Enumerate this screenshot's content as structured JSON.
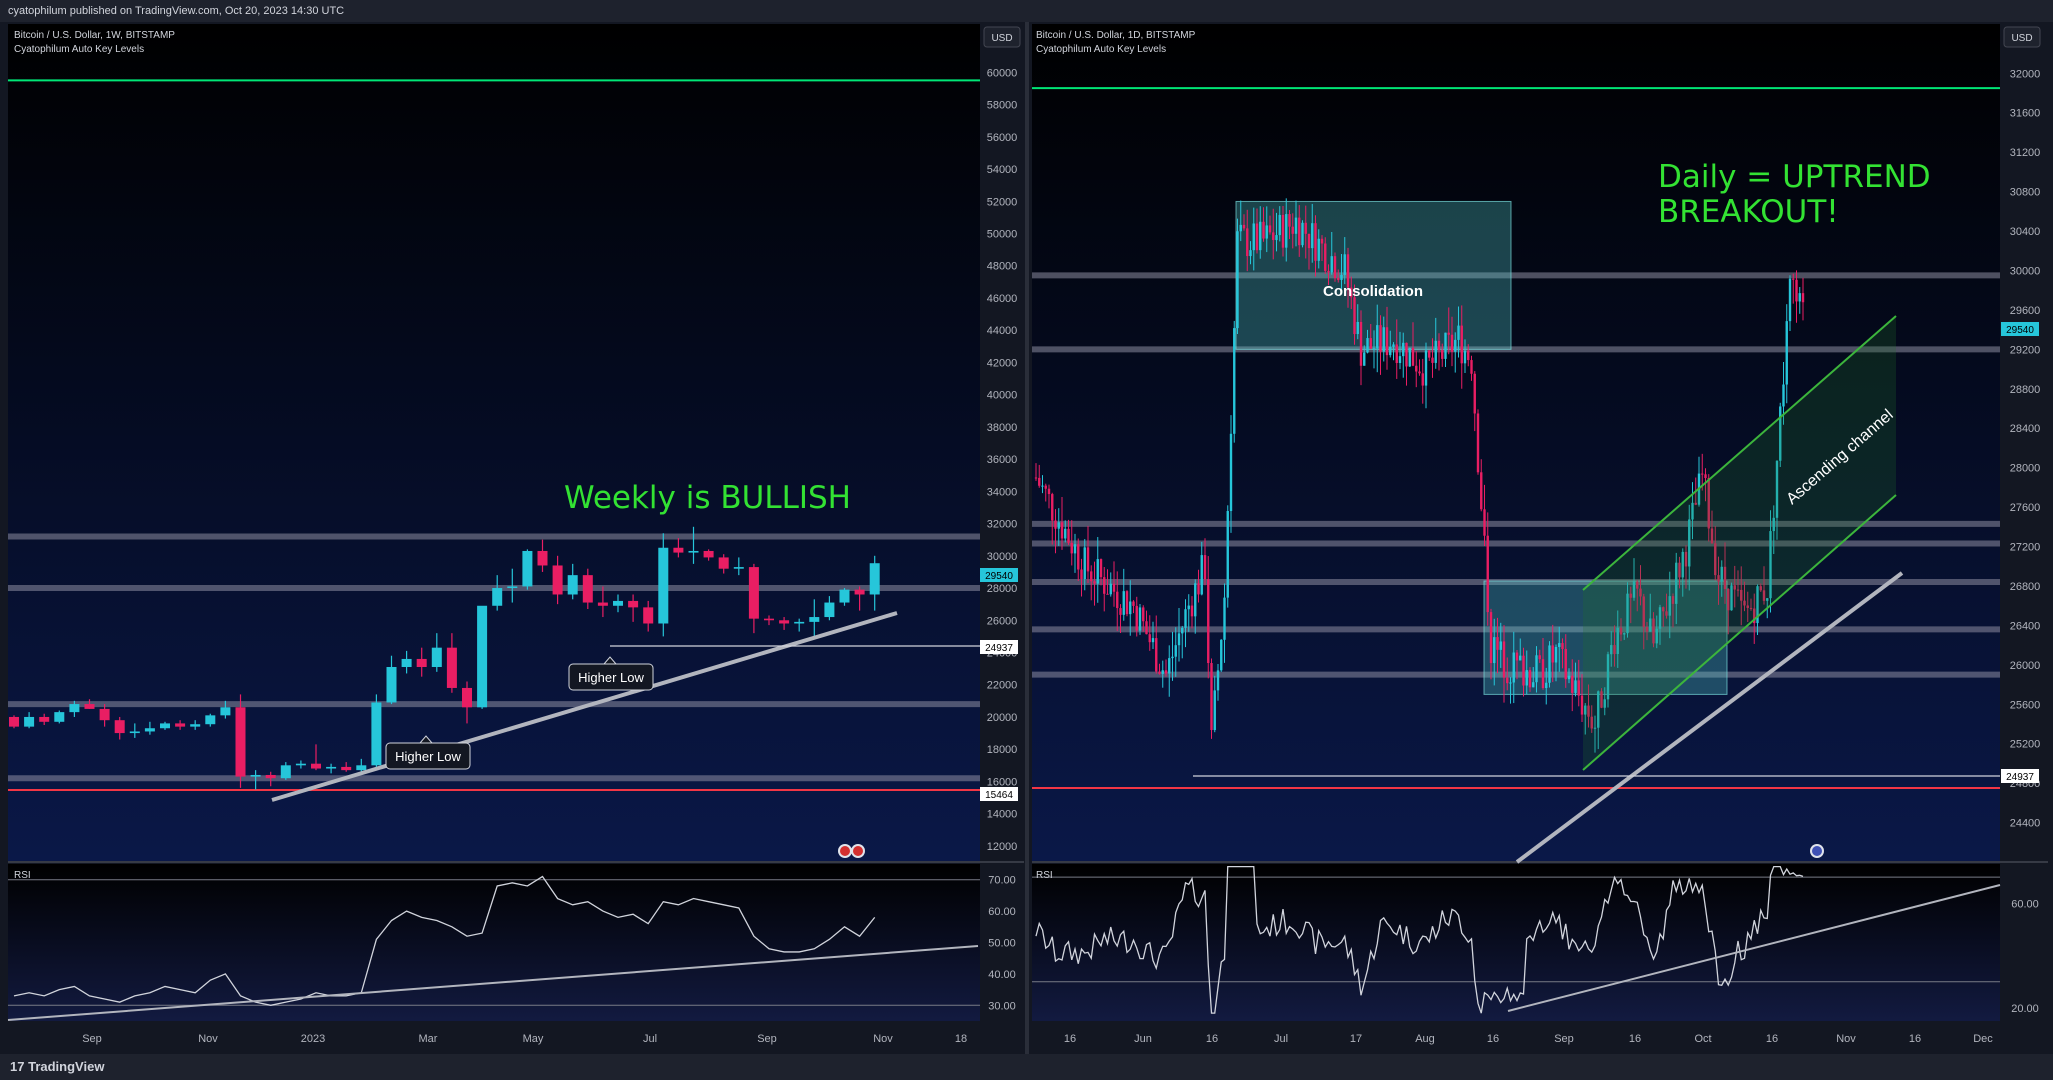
{
  "publish_info": "cyatophilum published on TradingView.com, Oct 20, 2023 14:30 UTC",
  "footer": {
    "brand": "TradingView",
    "logo_mark": "17"
  },
  "panels": {
    "weekly": {
      "symbol_line": "Bitcoin / U.S. Dollar, 1W, BITSTAMP",
      "indicator": "Cyatophilum Auto Key Levels",
      "currency": "USD",
      "rsi_label": "RSI",
      "price_tag": "29540",
      "level_tag_1": "24937",
      "level_tag_2": "15464",
      "annotation": "Weekly is BULLISH",
      "callout_1": "Higher Low",
      "callout_2": "Higher Low"
    },
    "daily": {
      "symbol_line": "Bitcoin / U.S. Dollar, 1D, BITSTAMP",
      "indicator": "Cyatophilum Auto Key Levels",
      "currency": "USD",
      "rsi_label": "RSI",
      "price_tag": "29540",
      "level_tag_1": "24937",
      "annotation_line1": "Daily = UPTREND",
      "annotation_line2": "BREAKOUT!",
      "box_label": "Consolidation",
      "channel_label": "Ascending channel"
    }
  },
  "colors": {
    "up": "#26c6da",
    "down": "#e91e63",
    "green_level": "#00e676",
    "red_level": "#f23645",
    "annotation": "#33e233",
    "background": "#131722"
  },
  "chart_data": [
    {
      "type": "candlestick",
      "title": "Bitcoin / U.S. Dollar, 1W, BITSTAMP",
      "ylim": [
        11000,
        63000
      ],
      "yticks": [
        12000,
        14000,
        16000,
        18000,
        20000,
        22000,
        24000,
        26000,
        28000,
        30000,
        32000,
        34000,
        36000,
        38000,
        40000,
        42000,
        44000,
        46000,
        48000,
        50000,
        52000,
        54000,
        56000,
        58000,
        60000,
        62000
      ],
      "xticks": [
        "Sep",
        "Nov",
        "2023",
        "Mar",
        "May",
        "Jul",
        "Sep",
        "Nov",
        "18"
      ],
      "key_levels": [
        59500,
        31200,
        28000,
        20800,
        16200,
        15464,
        24937
      ],
      "candles_ohlc": [
        [
          20000,
          20100,
          19300,
          19400
        ],
        [
          19400,
          20300,
          19300,
          20000
        ],
        [
          20000,
          20200,
          19500,
          19700
        ],
        [
          19700,
          20400,
          19600,
          20300
        ],
        [
          20300,
          21000,
          20000,
          20800
        ],
        [
          20800,
          21100,
          20500,
          20500
        ],
        [
          20500,
          20800,
          19400,
          19800
        ],
        [
          19800,
          20000,
          18600,
          19000
        ],
        [
          19000,
          19600,
          18700,
          19100
        ],
        [
          19100,
          19700,
          18900,
          19300
        ],
        [
          19300,
          19700,
          19200,
          19600
        ],
        [
          19600,
          19800,
          19200,
          19400
        ],
        [
          19400,
          19800,
          19200,
          19550
        ],
        [
          19550,
          20200,
          19400,
          20100
        ],
        [
          20100,
          21000,
          19900,
          20600
        ],
        [
          20600,
          21400,
          15600,
          16300
        ],
        [
          16300,
          16700,
          15500,
          16400
        ],
        [
          16400,
          16600,
          15700,
          16200
        ],
        [
          16200,
          17200,
          16100,
          17000
        ],
        [
          17000,
          17300,
          16800,
          17100
        ],
        [
          17100,
          18300,
          16700,
          16800
        ],
        [
          16800,
          17100,
          16500,
          16900
        ],
        [
          16900,
          17200,
          16600,
          16700
        ],
        [
          16700,
          17400,
          16500,
          17000
        ],
        [
          17000,
          21400,
          16900,
          20900
        ],
        [
          20900,
          23800,
          20800,
          23100
        ],
        [
          23100,
          24100,
          22700,
          23600
        ],
        [
          23600,
          24300,
          22500,
          23100
        ],
        [
          23100,
          25200,
          22800,
          24300
        ],
        [
          24300,
          25200,
          21500,
          21800
        ],
        [
          21800,
          22200,
          19600,
          20600
        ],
        [
          20600,
          26500,
          20500,
          26900
        ],
        [
          26900,
          28800,
          26600,
          28000
        ],
        [
          28000,
          29200,
          27100,
          28100
        ],
        [
          28100,
          30400,
          27900,
          30300
        ],
        [
          30300,
          31000,
          29000,
          29400
        ],
        [
          29400,
          30000,
          27000,
          27600
        ],
        [
          27600,
          29500,
          27300,
          28800
        ],
        [
          28800,
          29200,
          26700,
          27100
        ],
        [
          27100,
          28100,
          26200,
          26900
        ],
        [
          26900,
          27600,
          26500,
          27200
        ],
        [
          27200,
          27600,
          25900,
          26800
        ],
        [
          26800,
          27200,
          25300,
          25800
        ],
        [
          25800,
          31400,
          25000,
          30500
        ],
        [
          30500,
          31100,
          29900,
          30200
        ],
        [
          30200,
          31800,
          29500,
          30300
        ],
        [
          30300,
          30400,
          29700,
          29900
        ],
        [
          29900,
          30100,
          28900,
          29200
        ],
        [
          29200,
          29900,
          28800,
          29300
        ],
        [
          29300,
          29500,
          25200,
          26100
        ],
        [
          26100,
          26300,
          25700,
          26000
        ],
        [
          26000,
          26200,
          25400,
          25800
        ],
        [
          25800,
          26100,
          25300,
          25900
        ],
        [
          25900,
          27300,
          24900,
          26200
        ],
        [
          26200,
          27500,
          26000,
          27100
        ],
        [
          27100,
          28000,
          26900,
          27900
        ],
        [
          27900,
          28100,
          26600,
          27600
        ],
        [
          27600,
          30000,
          26600,
          29540
        ]
      ],
      "rsi": {
        "ylim": [
          25,
          75
        ],
        "yticks": [
          "30.00",
          "40.00",
          "50.00",
          "60.00",
          "70.00"
        ]
      },
      "annotations": [
        "Weekly is BULLISH",
        "Higher Low",
        "Higher Low"
      ]
    },
    {
      "type": "candlestick",
      "title": "Bitcoin / U.S. Dollar, 1D, BITSTAMP",
      "ylim": [
        24000,
        32500
      ],
      "yticks": [
        24400,
        24800,
        25200,
        25600,
        26000,
        26400,
        26800,
        27200,
        27600,
        28000,
        28400,
        28800,
        29200,
        29600,
        30000,
        30400,
        30800,
        31200,
        31600,
        32000
      ],
      "xticks": [
        "16",
        "Jun",
        "16",
        "Jul",
        "17",
        "Aug",
        "16",
        "Sep",
        "16",
        "Oct",
        "16",
        "Nov",
        "16",
        "Dec"
      ],
      "key_levels": [
        31850,
        29950,
        29200,
        27430,
        27230,
        26840,
        26360,
        25900,
        24750,
        24937
      ],
      "zones": [
        {
          "label": "Consolidation",
          "from_price": 29200,
          "to_price": 30700
        },
        {
          "label": "",
          "from_price": 25700,
          "to_price": 26850
        }
      ],
      "rsi": {
        "ylim": [
          15,
          75
        ],
        "yticks": [
          "20.00",
          "60.00"
        ]
      },
      "annotations": [
        "Daily = UPTREND",
        "BREAKOUT!",
        "Consolidation",
        "Ascending channel"
      ]
    }
  ]
}
